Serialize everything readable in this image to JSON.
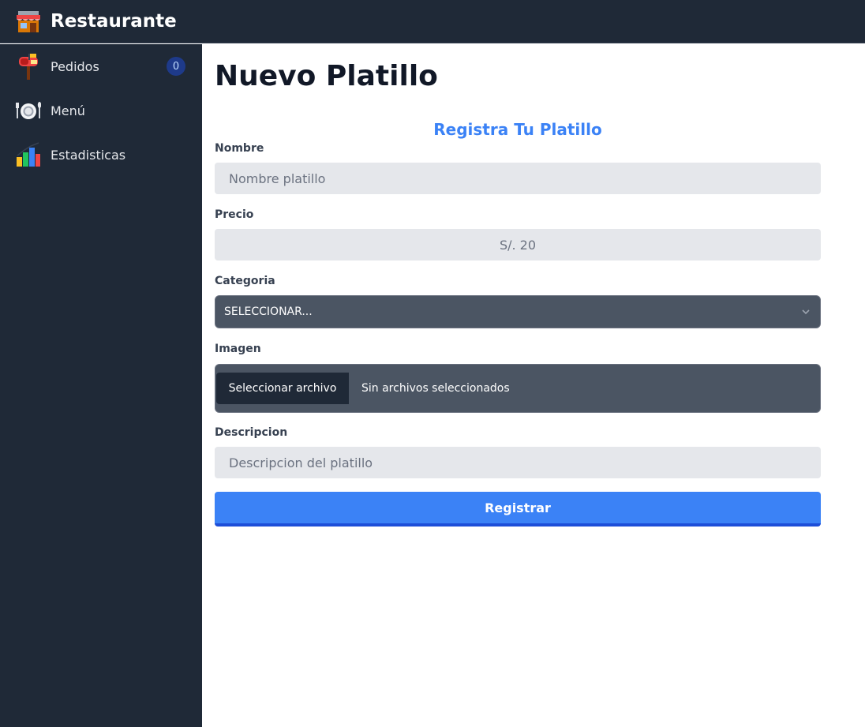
{
  "header": {
    "brand": "Restaurante",
    "logo_icon": "restaurant-storefront-icon"
  },
  "sidebar": {
    "items": [
      {
        "label": "Pedidos",
        "icon": "mailbox-icon",
        "badge": "0"
      },
      {
        "label": "Menú",
        "icon": "dinner-plate-icon"
      },
      {
        "label": "Estadisticas",
        "icon": "bar-chart-icon"
      }
    ]
  },
  "main": {
    "title": "Nuevo Platillo",
    "form": {
      "title": "Registra Tu Platillo",
      "nombre": {
        "label": "Nombre",
        "placeholder": "Nombre platillo"
      },
      "precio": {
        "label": "Precio",
        "placeholder": "S/. 20"
      },
      "categoria": {
        "label": "Categoria",
        "selected": "SELECCIONAR..."
      },
      "imagen": {
        "label": "Imagen",
        "button": "Seleccionar archivo",
        "status": "Sin archivos seleccionados"
      },
      "descripcion": {
        "label": "Descripcion",
        "placeholder": "Descripcion del platillo"
      },
      "submit": "Registrar"
    }
  },
  "colors": {
    "sidebar_bg": "#1f2937",
    "accent": "#3b82f6",
    "input_bg": "#e5e7eb",
    "select_bg": "#4b5563"
  }
}
